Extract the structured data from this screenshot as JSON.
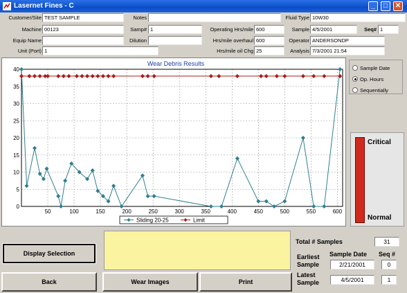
{
  "window": {
    "title": "Lasernet Fines - C",
    "controls": {
      "minimize": "_",
      "maximize": "□",
      "close": "✕"
    }
  },
  "header": {
    "customer_site": {
      "label": "Customer/Site",
      "value": "TEST SAMPLE"
    },
    "machine": {
      "label": "Machine",
      "value": "00123"
    },
    "equip_name": {
      "label": "Equip Name",
      "value": ""
    },
    "unit_port": {
      "label": "Unit (Port)",
      "value": "1"
    },
    "notes": {
      "label": "Notes",
      "value": ""
    },
    "samp_num": {
      "label": "Samp#",
      "value": "1"
    },
    "dilution": {
      "label": "Dilution",
      "value": ""
    },
    "operating_hrs": {
      "label": "Operating Hrs/mile",
      "value": "600"
    },
    "hrs_overhaul": {
      "label": "Hrs/mile overhaul",
      "value": "600"
    },
    "hrs_oil_chg": {
      "label": "Hrs/mile oil Chg",
      "value": "25"
    },
    "fluid_type": {
      "label": "Fluid Type",
      "value": "10W30"
    },
    "sample": {
      "label": "Sample",
      "value": "4/5/2001"
    },
    "seq": {
      "label": "Seq#",
      "value": "1"
    },
    "operator": {
      "label": "Operator",
      "value": "ANDERSONDP"
    },
    "analysis": {
      "label": "Analysis",
      "value": "7/3/2001 21:54"
    }
  },
  "right_panel": {
    "radio_options": [
      {
        "label": "Sample Date",
        "checked": false
      },
      {
        "label": "Op. Hours",
        "checked": true
      },
      {
        "label": "Sequentially",
        "checked": false
      }
    ],
    "gauge": {
      "top_label": "Critical",
      "bottom_label": "Normal",
      "color": "#cf2a1c"
    }
  },
  "buttons": {
    "display_selection": "Display Selection",
    "back": "Back",
    "wear_images": "Wear Images",
    "print": "Print"
  },
  "stats": {
    "total_samples_label": "Total # Samples",
    "total_samples": "31",
    "sample_date_header": "Sample Date",
    "seq_header": "Seq #",
    "earliest_label_1": "Earliest",
    "earliest_label_2": "Sample",
    "earliest_date": "2/21/2001",
    "earliest_seq": "0",
    "latest_label_1": "Latest",
    "latest_label_2": "Sample",
    "latest_date": "4/5/2001",
    "latest_seq": "1"
  },
  "chart_data": {
    "type": "line",
    "title": "Wear Debris Results",
    "xlim": [
      0,
      610
    ],
    "ylim": [
      0,
      40
    ],
    "x_ticks": [
      50,
      100,
      150,
      200,
      250,
      300,
      350,
      400,
      450,
      500,
      550,
      600
    ],
    "y_ticks": [
      0,
      5,
      10,
      15,
      20,
      25,
      30,
      35,
      40
    ],
    "grid": true,
    "legend_position": "bottom",
    "series": [
      {
        "name": "Sliding 20-25",
        "color": "#2f7f8f",
        "marker": "diamond",
        "points": [
          [
            0,
            40
          ],
          [
            10,
            6
          ],
          [
            25,
            17
          ],
          [
            35,
            9.5
          ],
          [
            42,
            8
          ],
          [
            48,
            11
          ],
          [
            70,
            3
          ],
          [
            75,
            0
          ],
          [
            83,
            7.5
          ],
          [
            95,
            12.5
          ],
          [
            110,
            10
          ],
          [
            125,
            8
          ],
          [
            135,
            10.5
          ],
          [
            145,
            4.5
          ],
          [
            155,
            3
          ],
          [
            165,
            1.5
          ],
          [
            175,
            6
          ],
          [
            190,
            0
          ],
          [
            230,
            9
          ],
          [
            240,
            3
          ],
          [
            252,
            3
          ],
          [
            360,
            0
          ],
          [
            380,
            0
          ],
          [
            410,
            14
          ],
          [
            450,
            1.5
          ],
          [
            465,
            1.5
          ],
          [
            480,
            0
          ],
          [
            500,
            1.5
          ],
          [
            535,
            20
          ],
          [
            555,
            0
          ],
          [
            575,
            0
          ],
          [
            605,
            40
          ]
        ]
      },
      {
        "name": "Limit",
        "color": "#aa1c1c",
        "marker": "diamond",
        "constant": 38,
        "points": [
          [
            0,
            38
          ],
          [
            15,
            38
          ],
          [
            25,
            38
          ],
          [
            35,
            38
          ],
          [
            45,
            38
          ],
          [
            50,
            38
          ],
          [
            70,
            38
          ],
          [
            80,
            38
          ],
          [
            90,
            38
          ],
          [
            105,
            38
          ],
          [
            115,
            38
          ],
          [
            125,
            38
          ],
          [
            135,
            38
          ],
          [
            145,
            38
          ],
          [
            155,
            38
          ],
          [
            165,
            38
          ],
          [
            175,
            38
          ],
          [
            230,
            38
          ],
          [
            240,
            38
          ],
          [
            252,
            38
          ],
          [
            360,
            38
          ],
          [
            375,
            38
          ],
          [
            410,
            38
          ],
          [
            455,
            38
          ],
          [
            465,
            38
          ],
          [
            485,
            38
          ],
          [
            500,
            38
          ],
          [
            535,
            38
          ],
          [
            555,
            38
          ],
          [
            575,
            38
          ],
          [
            605,
            38
          ]
        ]
      }
    ]
  }
}
